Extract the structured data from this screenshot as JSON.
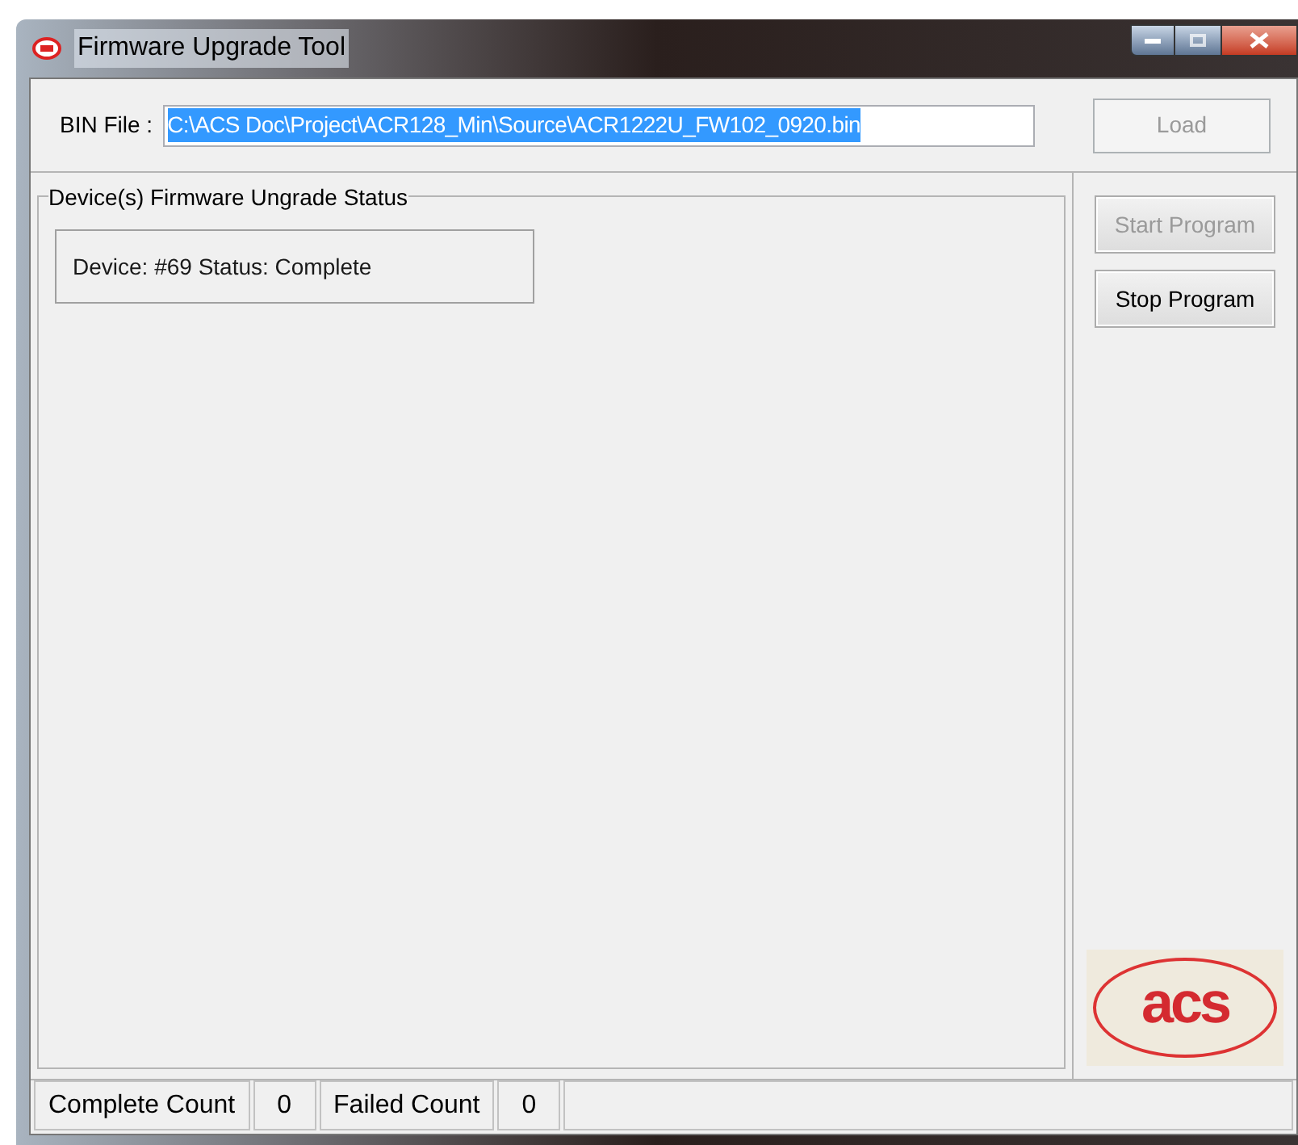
{
  "window": {
    "title": "Firmware Upgrade Tool"
  },
  "bin_file": {
    "label": "BIN File :",
    "value": "C:\\ACS Doc\\Project\\ACR128_Min\\Source\\ACR1222U_FW102_0920.bin",
    "selected": true
  },
  "load_button": {
    "label": "Load",
    "disabled": true
  },
  "status_group": {
    "title": "Device(s) Firmware Ungrade Status",
    "devices": [
      "Device: #69 Status: Complete"
    ]
  },
  "side_buttons": [
    {
      "label": "Start Program",
      "disabled": true
    },
    {
      "label": "Stop Program",
      "disabled": false
    }
  ],
  "logo": {
    "text": "acs"
  },
  "status_bar": [
    {
      "text": "Complete Count"
    },
    {
      "text": "0"
    },
    {
      "text": "Failed Count"
    },
    {
      "text": "0"
    }
  ]
}
